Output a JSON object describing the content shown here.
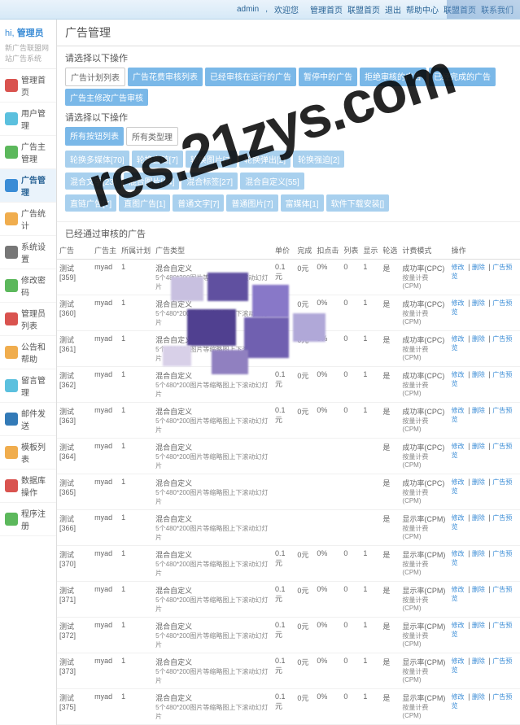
{
  "topbar": {
    "user": "admin",
    "welcome": "欢迎您",
    "links": [
      "管理首页",
      "联盟首页",
      "退出",
      "帮助中心",
      "联盟首页",
      "联系我们"
    ]
  },
  "sidebar": {
    "greeting_prefix": "hi,",
    "greeting_name": "管理员",
    "subtitle": "新广告联盟网站广告系统",
    "items": [
      {
        "label": "管理首页",
        "color": "#d9534f"
      },
      {
        "label": "用户管理",
        "color": "#5bc0de"
      },
      {
        "label": "广告主管理",
        "color": "#5cb85c"
      },
      {
        "label": "广告管理",
        "color": "#3a8cd6",
        "active": true
      },
      {
        "label": "广告统计",
        "color": "#f0ad4e"
      },
      {
        "label": "系统设置",
        "color": "#777"
      },
      {
        "label": "修改密码",
        "color": "#5cb85c"
      },
      {
        "label": "管理员列表",
        "color": "#d9534f"
      },
      {
        "label": "公告和帮助",
        "color": "#f0ad4e"
      },
      {
        "label": "留言管理",
        "color": "#5bc0de"
      },
      {
        "label": "邮件发送",
        "color": "#337ab7"
      },
      {
        "label": "模板列表",
        "color": "#f0ad4e"
      },
      {
        "label": "数据库操作",
        "color": "#d9534f"
      },
      {
        "label": "程序注册",
        "color": "#5cb85c"
      }
    ]
  },
  "page_title": "广告管理",
  "select_label": "请选择以下操作",
  "tabs1": [
    "广告计划列表",
    "广告花费审核列表",
    "已经审核在运行的广告",
    "暂停中的广告",
    "拒绝审核的广告",
    "已经完成的广告",
    "广告主修改广告审核"
  ],
  "tabs2": [
    "所有按钮列表",
    "所有类型理"
  ],
  "tabs3": [
    "轮换多媒体[70]",
    "轮换直链[7]",
    "轮换图片[7]",
    "轮换弹出[2]",
    "轮换强迫[2]"
  ],
  "tabs4": [
    "混合文字[23]",
    "混合图片[24]",
    "混合标签[27]",
    "混合自定义[55]"
  ],
  "tabs5": [
    "直链广告[7]",
    "直图广告[1]",
    "普通文字[7]",
    "普通图片[7]",
    "富媒体[1]",
    "软件下载安装[]"
  ],
  "table_title": "已经通过审核的广告",
  "columns": [
    "广告",
    "广告主",
    "所属计划",
    "广告类型",
    "单价",
    "完成",
    "扣点击",
    "列表",
    "显示",
    "轮选",
    "计费模式",
    "操作"
  ],
  "type_line1": "混合自定义",
  "type_line2": "5个480*200图片等缩略图上下滚动幻灯片",
  "mode_line1": "成功率(CPC)",
  "mode_line2": "按量计费(CPM)",
  "mode_alt1": "显示率(CPM)",
  "mode_alt2": "按量计费(CPM)",
  "ops": [
    "修改",
    "删除",
    "广告预览"
  ],
  "rows": [
    {
      "name": "测试[359]",
      "owner": "myad",
      "plan": "1",
      "price": "0.1元",
      "done": "0元",
      "click": "0%",
      "list": "0",
      "show": "1",
      "sel": "是",
      "alt": false
    },
    {
      "name": "测试[360]",
      "owner": "myad",
      "plan": "1",
      "price": "0.1元",
      "done": "0元",
      "click": "0%",
      "list": "0",
      "show": "1",
      "sel": "是",
      "alt": false
    },
    {
      "name": "测试[361]",
      "owner": "myad",
      "plan": "1",
      "price": "0.1元",
      "done": "0元",
      "click": "0%",
      "list": "0",
      "show": "1",
      "sel": "是",
      "alt": false
    },
    {
      "name": "测试[362]",
      "owner": "myad",
      "plan": "1",
      "price": "0.1元",
      "done": "0元",
      "click": "0%",
      "list": "0",
      "show": "1",
      "sel": "是",
      "alt": false
    },
    {
      "name": "测试[363]",
      "owner": "myad",
      "plan": "1",
      "price": "0.1元",
      "done": "0元",
      "click": "0%",
      "list": "0",
      "show": "1",
      "sel": "是",
      "alt": false
    },
    {
      "name": "测试[364]",
      "owner": "myad",
      "plan": "1",
      "price": "",
      "done": "",
      "click": "",
      "list": "",
      "show": "",
      "sel": "是",
      "alt": false
    },
    {
      "name": "测试[365]",
      "owner": "myad",
      "plan": "1",
      "price": "",
      "done": "",
      "click": "",
      "list": "",
      "show": "",
      "sel": "是",
      "alt": false
    },
    {
      "name": "测试[366]",
      "owner": "myad",
      "plan": "1",
      "price": "",
      "done": "",
      "click": "",
      "list": "",
      "show": "",
      "sel": "是",
      "alt": true
    },
    {
      "name": "测试[370]",
      "owner": "myad",
      "plan": "1",
      "price": "0.1元",
      "done": "0元",
      "click": "0%",
      "list": "0",
      "show": "1",
      "sel": "是",
      "alt": true
    },
    {
      "name": "测试[371]",
      "owner": "myad",
      "plan": "1",
      "price": "0.1元",
      "done": "0元",
      "click": "0%",
      "list": "0",
      "show": "1",
      "sel": "是",
      "alt": true
    },
    {
      "name": "测试[372]",
      "owner": "myad",
      "plan": "1",
      "price": "0.1元",
      "done": "0元",
      "click": "0%",
      "list": "0",
      "show": "1",
      "sel": "是",
      "alt": true
    },
    {
      "name": "测试[373]",
      "owner": "myad",
      "plan": "1",
      "price": "0.1元",
      "done": "0元",
      "click": "0%",
      "list": "0",
      "show": "1",
      "sel": "是",
      "alt": true
    },
    {
      "name": "测试[375]",
      "owner": "myad",
      "plan": "1",
      "price": "0.1元",
      "done": "0元",
      "click": "0%",
      "list": "0",
      "show": "1",
      "sel": "是",
      "alt": true
    }
  ],
  "watermark": "res.21zys.com"
}
